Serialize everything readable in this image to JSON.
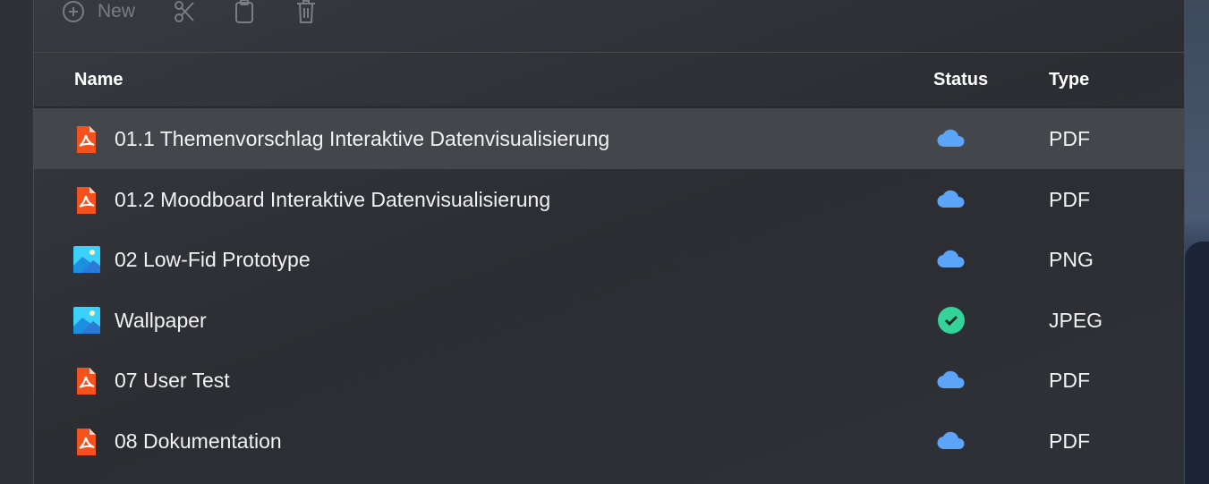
{
  "toolbar": {
    "new_label": "New"
  },
  "table": {
    "headers": {
      "name": "Name",
      "status": "Status",
      "type": "Type"
    },
    "rows": [
      {
        "name": "01.1 Themenvorschlag Interaktive Datenvisualisierung",
        "icon": "pdf",
        "status": "cloud",
        "type": "PDF",
        "selected": true
      },
      {
        "name": "01.2 Moodboard Interaktive Datenvisualisierung",
        "icon": "pdf",
        "status": "cloud",
        "type": "PDF"
      },
      {
        "name": "02 Low-Fid Prototype",
        "icon": "image",
        "status": "cloud",
        "type": "PNG"
      },
      {
        "name": "Wallpaper",
        "icon": "image",
        "status": "synced",
        "type": "JPEG"
      },
      {
        "name": "07 User Test",
        "icon": "pdf",
        "status": "cloud",
        "type": "PDF"
      },
      {
        "name": "08 Dokumentation",
        "icon": "pdf",
        "status": "cloud",
        "type": "PDF"
      }
    ]
  },
  "colors": {
    "pdf": "#f4511e",
    "cloud": "#5ca4f8",
    "synced": "#34d399",
    "selected_row": "#43464b"
  }
}
